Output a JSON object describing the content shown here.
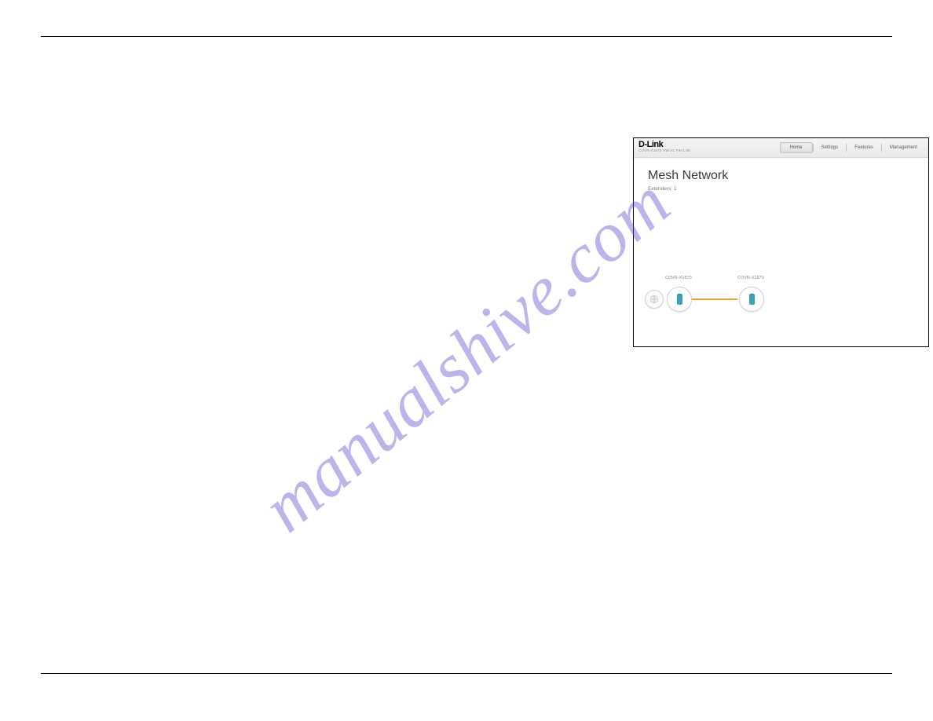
{
  "watermark": "manualshive.com",
  "screenshot": {
    "brand": "D-Link",
    "brand_sub": "COVR-X1870 HW:A1 FW:1.06",
    "nav": {
      "home": "Home",
      "settings": "Settings",
      "features": "Features",
      "management": "Management"
    },
    "title": "Mesh Network",
    "extenders_label": "Extenders: 1",
    "nodes": {
      "master_label": "COVR-X1870",
      "extender_label": "COVR-X1870"
    }
  }
}
